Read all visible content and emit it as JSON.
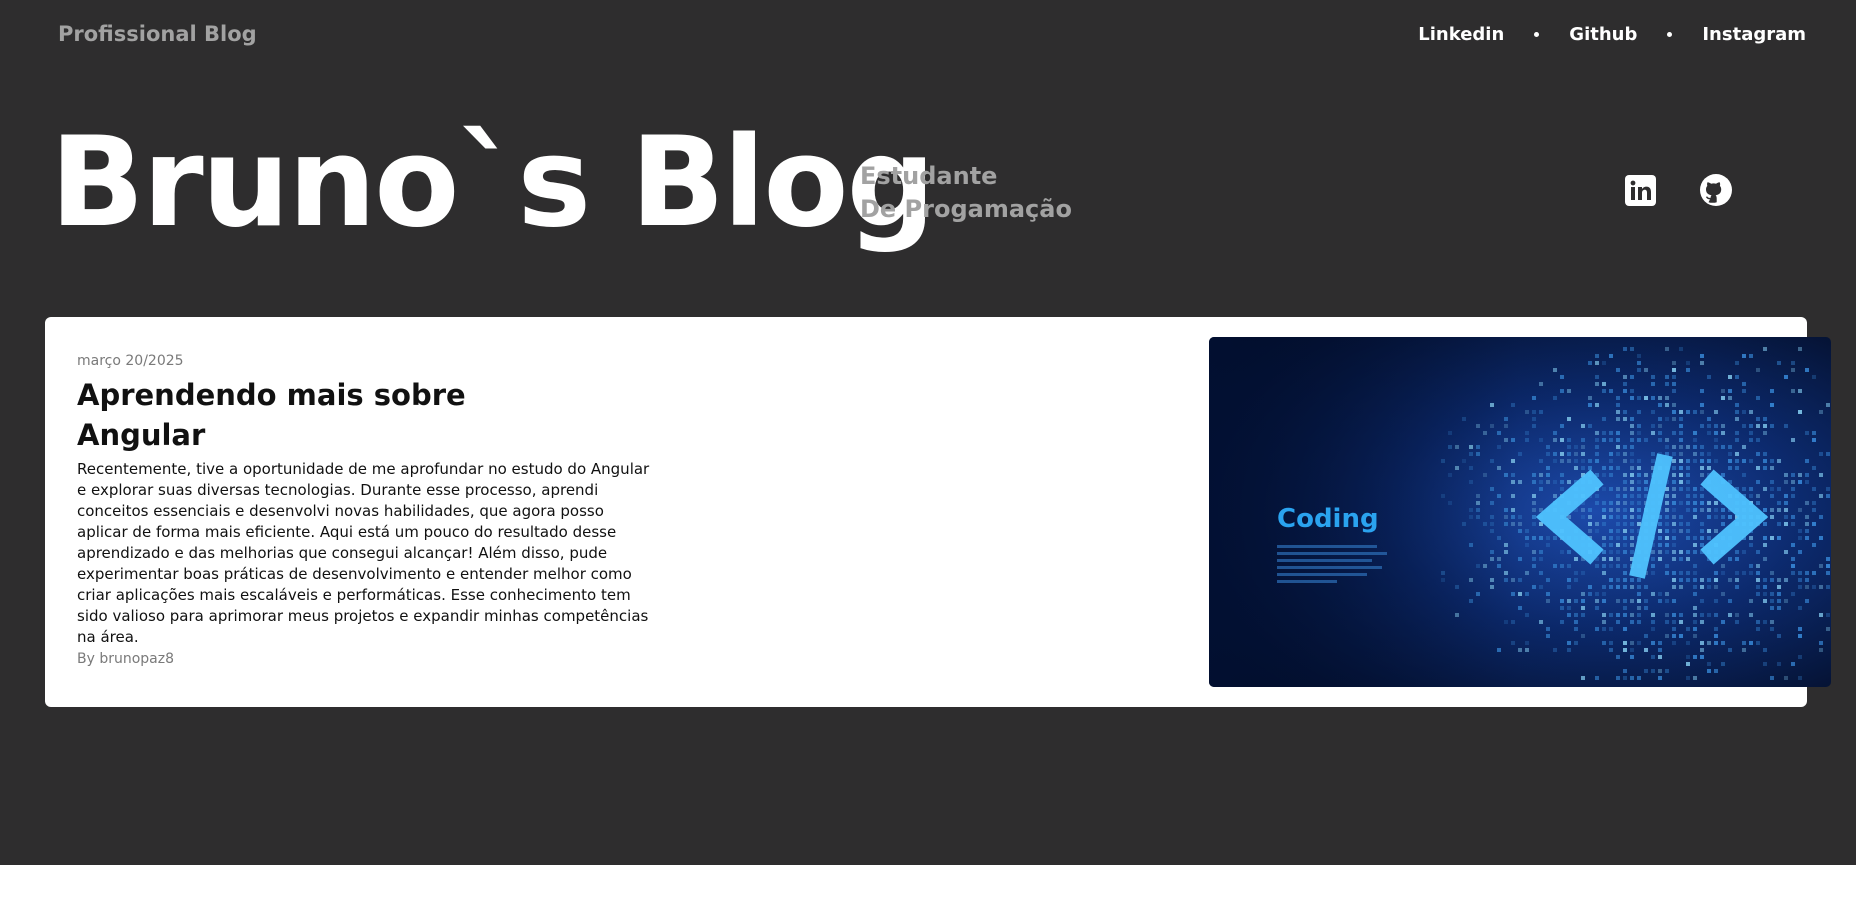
{
  "header": {
    "brand": "Profissional Blog",
    "nav": [
      {
        "label": "Linkedin"
      },
      {
        "label": "Github"
      },
      {
        "label": "Instagram"
      }
    ]
  },
  "hero": {
    "title": "Bruno`s Blog",
    "subtitle_line1": "Estudante",
    "subtitle_line2": "De Progamação",
    "social_icons": [
      "linkedin-icon",
      "github-icon"
    ]
  },
  "post": {
    "date": "março 20/2025",
    "title": "Aprendendo mais sobre Angular",
    "body": "Recentemente, tive a oportunidade de me aprofundar no estudo do Angular e explorar suas diversas tecnologias. Durante esse processo, aprendi conceitos essenciais e desenvolvi novas habilidades, que agora posso aplicar de forma mais eficiente. Aqui está um pouco do resultado desse aprendizado e das melhorias que consegui alcançar! Além disso, pude experimentar boas práticas de desenvolvimento e entender melhor como criar aplicações mais escaláveis e performáticas. Esse conhecimento tem sido valioso para aprimorar meus projetos e expandir minhas competências na área.",
    "author": "By brunopaz8",
    "image": {
      "heading": "Coding",
      "symbol": "</>"
    }
  },
  "colors": {
    "background": "#2e2d2e",
    "muted_text": "#a2a2a2",
    "card": "#ffffff",
    "image_accent": "#2aa3ef"
  }
}
